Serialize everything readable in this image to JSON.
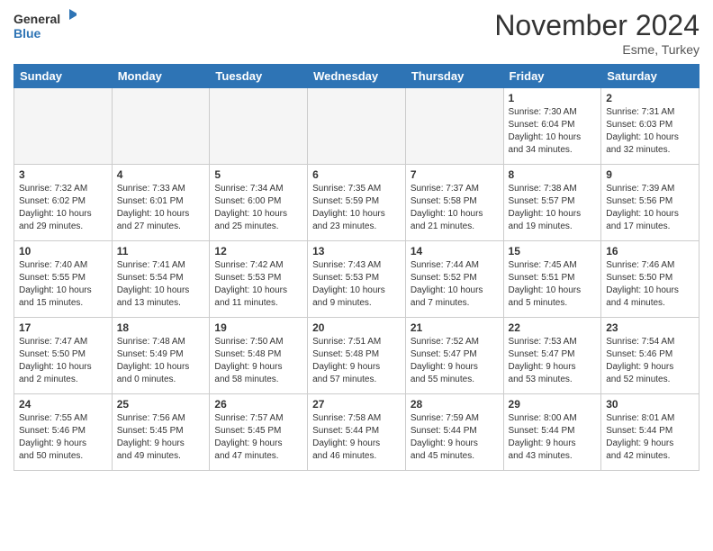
{
  "header": {
    "logo_general": "General",
    "logo_blue": "Blue",
    "month_title": "November 2024",
    "location": "Esme, Turkey"
  },
  "weekdays": [
    "Sunday",
    "Monday",
    "Tuesday",
    "Wednesday",
    "Thursday",
    "Friday",
    "Saturday"
  ],
  "weeks": [
    [
      {
        "day": "",
        "info": ""
      },
      {
        "day": "",
        "info": ""
      },
      {
        "day": "",
        "info": ""
      },
      {
        "day": "",
        "info": ""
      },
      {
        "day": "",
        "info": ""
      },
      {
        "day": "1",
        "info": "Sunrise: 7:30 AM\nSunset: 6:04 PM\nDaylight: 10 hours\nand 34 minutes."
      },
      {
        "day": "2",
        "info": "Sunrise: 7:31 AM\nSunset: 6:03 PM\nDaylight: 10 hours\nand 32 minutes."
      }
    ],
    [
      {
        "day": "3",
        "info": "Sunrise: 7:32 AM\nSunset: 6:02 PM\nDaylight: 10 hours\nand 29 minutes."
      },
      {
        "day": "4",
        "info": "Sunrise: 7:33 AM\nSunset: 6:01 PM\nDaylight: 10 hours\nand 27 minutes."
      },
      {
        "day": "5",
        "info": "Sunrise: 7:34 AM\nSunset: 6:00 PM\nDaylight: 10 hours\nand 25 minutes."
      },
      {
        "day": "6",
        "info": "Sunrise: 7:35 AM\nSunset: 5:59 PM\nDaylight: 10 hours\nand 23 minutes."
      },
      {
        "day": "7",
        "info": "Sunrise: 7:37 AM\nSunset: 5:58 PM\nDaylight: 10 hours\nand 21 minutes."
      },
      {
        "day": "8",
        "info": "Sunrise: 7:38 AM\nSunset: 5:57 PM\nDaylight: 10 hours\nand 19 minutes."
      },
      {
        "day": "9",
        "info": "Sunrise: 7:39 AM\nSunset: 5:56 PM\nDaylight: 10 hours\nand 17 minutes."
      }
    ],
    [
      {
        "day": "10",
        "info": "Sunrise: 7:40 AM\nSunset: 5:55 PM\nDaylight: 10 hours\nand 15 minutes."
      },
      {
        "day": "11",
        "info": "Sunrise: 7:41 AM\nSunset: 5:54 PM\nDaylight: 10 hours\nand 13 minutes."
      },
      {
        "day": "12",
        "info": "Sunrise: 7:42 AM\nSunset: 5:53 PM\nDaylight: 10 hours\nand 11 minutes."
      },
      {
        "day": "13",
        "info": "Sunrise: 7:43 AM\nSunset: 5:53 PM\nDaylight: 10 hours\nand 9 minutes."
      },
      {
        "day": "14",
        "info": "Sunrise: 7:44 AM\nSunset: 5:52 PM\nDaylight: 10 hours\nand 7 minutes."
      },
      {
        "day": "15",
        "info": "Sunrise: 7:45 AM\nSunset: 5:51 PM\nDaylight: 10 hours\nand 5 minutes."
      },
      {
        "day": "16",
        "info": "Sunrise: 7:46 AM\nSunset: 5:50 PM\nDaylight: 10 hours\nand 4 minutes."
      }
    ],
    [
      {
        "day": "17",
        "info": "Sunrise: 7:47 AM\nSunset: 5:50 PM\nDaylight: 10 hours\nand 2 minutes."
      },
      {
        "day": "18",
        "info": "Sunrise: 7:48 AM\nSunset: 5:49 PM\nDaylight: 10 hours\nand 0 minutes."
      },
      {
        "day": "19",
        "info": "Sunrise: 7:50 AM\nSunset: 5:48 PM\nDaylight: 9 hours\nand 58 minutes."
      },
      {
        "day": "20",
        "info": "Sunrise: 7:51 AM\nSunset: 5:48 PM\nDaylight: 9 hours\nand 57 minutes."
      },
      {
        "day": "21",
        "info": "Sunrise: 7:52 AM\nSunset: 5:47 PM\nDaylight: 9 hours\nand 55 minutes."
      },
      {
        "day": "22",
        "info": "Sunrise: 7:53 AM\nSunset: 5:47 PM\nDaylight: 9 hours\nand 53 minutes."
      },
      {
        "day": "23",
        "info": "Sunrise: 7:54 AM\nSunset: 5:46 PM\nDaylight: 9 hours\nand 52 minutes."
      }
    ],
    [
      {
        "day": "24",
        "info": "Sunrise: 7:55 AM\nSunset: 5:46 PM\nDaylight: 9 hours\nand 50 minutes."
      },
      {
        "day": "25",
        "info": "Sunrise: 7:56 AM\nSunset: 5:45 PM\nDaylight: 9 hours\nand 49 minutes."
      },
      {
        "day": "26",
        "info": "Sunrise: 7:57 AM\nSunset: 5:45 PM\nDaylight: 9 hours\nand 47 minutes."
      },
      {
        "day": "27",
        "info": "Sunrise: 7:58 AM\nSunset: 5:44 PM\nDaylight: 9 hours\nand 46 minutes."
      },
      {
        "day": "28",
        "info": "Sunrise: 7:59 AM\nSunset: 5:44 PM\nDaylight: 9 hours\nand 45 minutes."
      },
      {
        "day": "29",
        "info": "Sunrise: 8:00 AM\nSunset: 5:44 PM\nDaylight: 9 hours\nand 43 minutes."
      },
      {
        "day": "30",
        "info": "Sunrise: 8:01 AM\nSunset: 5:44 PM\nDaylight: 9 hours\nand 42 minutes."
      }
    ]
  ]
}
